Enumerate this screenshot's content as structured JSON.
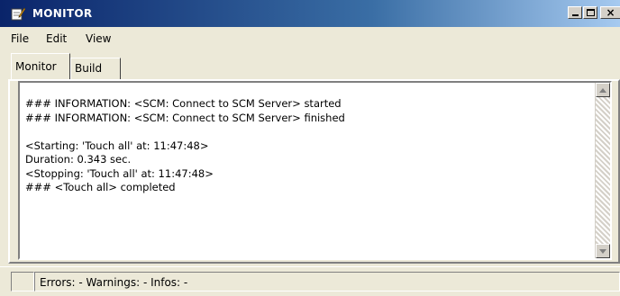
{
  "window": {
    "title": "MONITOR",
    "icon": "notepad-pencil-icon",
    "controls": {
      "minimize": "minimize-icon",
      "maximize": "maximize-icon",
      "close": "close-icon"
    }
  },
  "menu": {
    "items": [
      {
        "label": "File"
      },
      {
        "label": "Edit"
      },
      {
        "label": "View"
      }
    ]
  },
  "tabs": [
    {
      "label": "Monitor",
      "active": true
    },
    {
      "label": "Build",
      "active": false
    }
  ],
  "log": {
    "lines": [
      "### INFORMATION: <SCM: Connect to SCM Server> started",
      "### INFORMATION: <SCM: Connect to SCM Server> finished",
      "",
      "<Starting: 'Touch all' at: 11:47:48>",
      "Duration: 0.343 sec.",
      "<Stopping: 'Touch all' at: 11:47:48>",
      "### <Touch all> completed"
    ]
  },
  "status": {
    "text": "Errors: -   Warnings: -   Infos: -"
  },
  "colors": {
    "titlebar_start": "#0a246a",
    "titlebar_end": "#a6caf0",
    "face": "#ece9d8"
  }
}
